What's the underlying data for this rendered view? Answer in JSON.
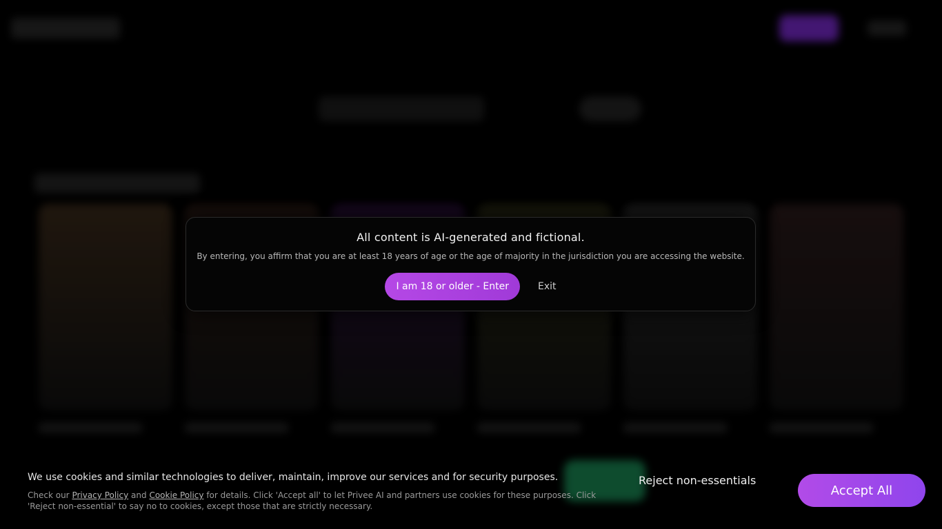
{
  "age_gate": {
    "title": "All content is AI-generated and fictional.",
    "description": "By entering, you affirm that you are at least 18 years of age or the age of majority in the jurisdiction you are accessing the website.",
    "enter_label": "I am 18 or older - Enter",
    "exit_label": "Exit"
  },
  "cookie_banner": {
    "main_text": "We use cookies and similar technologies to deliver, maintain, improve our services and for security purposes.",
    "detail_prefix": "Check our ",
    "privacy_link": "Privacy Policy",
    "detail_and": " and ",
    "cookie_link": "Cookie Policy",
    "detail_suffix": " for details. Click 'Accept all' to let Privee AI and partners use cookies for these purposes. Click 'Reject non-essential' to say no to cookies, except those that are strictly necessary.",
    "reject_label": "Reject non-essentials",
    "accept_label": "Accept All"
  },
  "colors": {
    "accent_purple": "#b548e6",
    "accept_gradient_end": "#8f45ec",
    "background": "#000000"
  },
  "background_cards": [
    {
      "color": "#3a2a1a"
    },
    {
      "color": "#2a1a14"
    },
    {
      "color": "#2a0f3a"
    },
    {
      "color": "#2a2a14"
    },
    {
      "color": "#2a2a2a"
    },
    {
      "color": "#2a1a1a"
    }
  ]
}
